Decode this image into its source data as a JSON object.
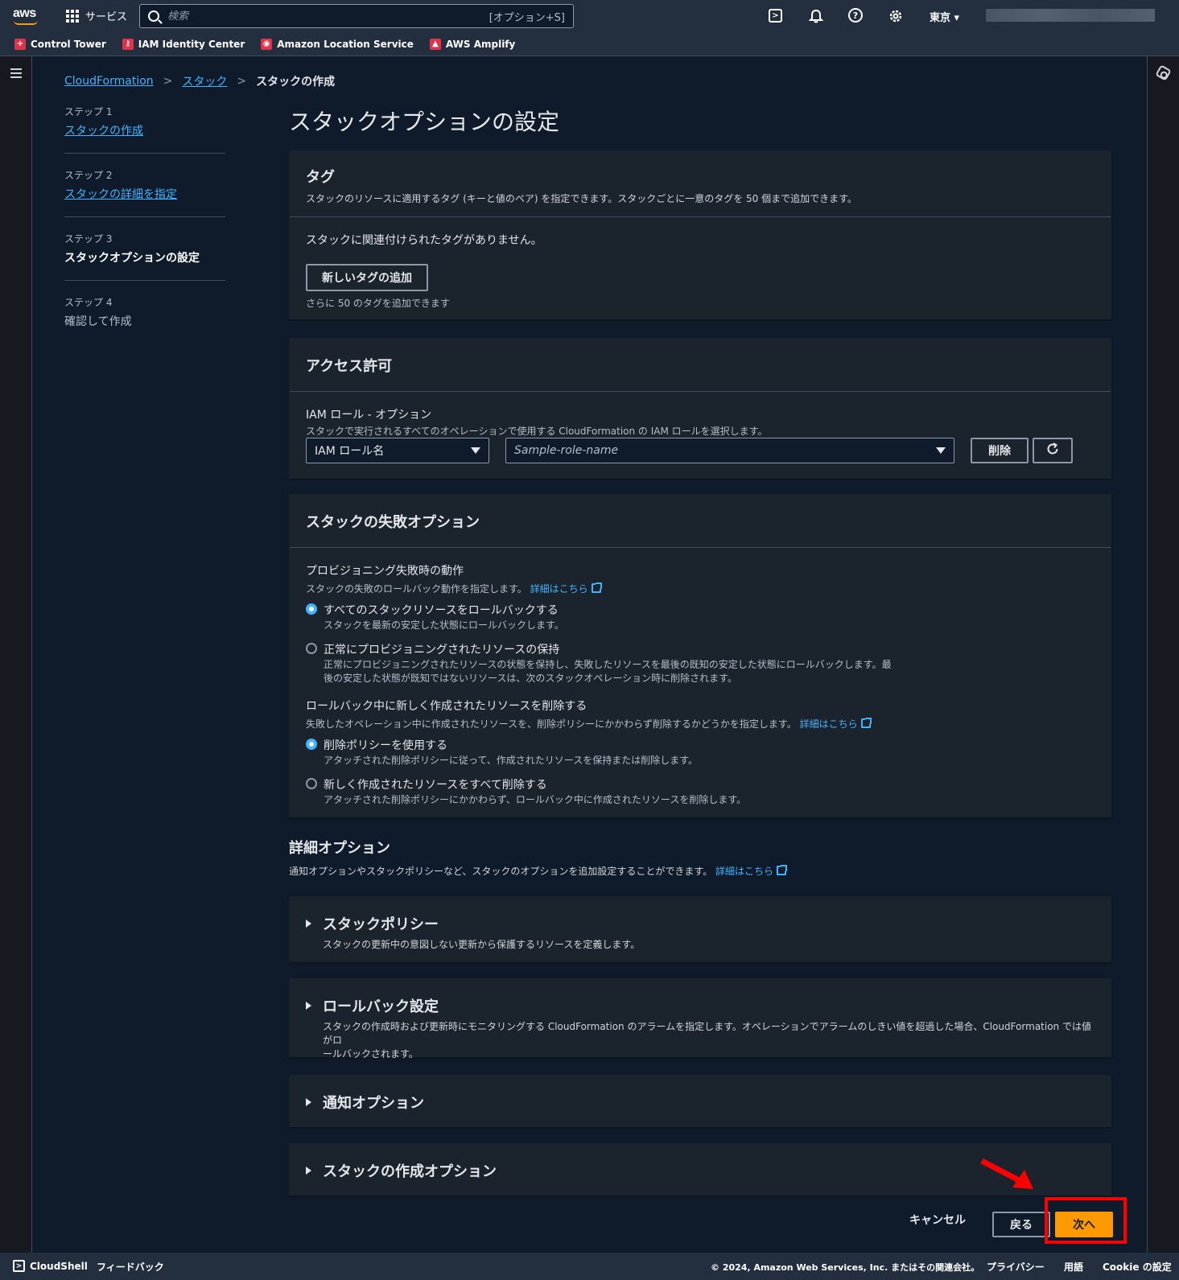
{
  "topnav": {
    "logo_text": "aws",
    "services_label": "サービス",
    "search_placeholder": "検索",
    "search_shortcut": "[オプション+S]",
    "region": "東京 ▾"
  },
  "favorites": [
    {
      "label": "Control Tower",
      "icon": "control-tower-icon"
    },
    {
      "label": "IAM Identity Center",
      "icon": "iam-identity-center-icon"
    },
    {
      "label": "Amazon Location Service",
      "icon": "location-service-icon"
    },
    {
      "label": "AWS Amplify",
      "icon": "amplify-icon"
    }
  ],
  "breadcrumb": {
    "items": [
      "CloudFormation",
      "スタック"
    ],
    "current": "スタックの作成"
  },
  "steps": [
    {
      "num": "ステップ 1",
      "label": "スタックの作成"
    },
    {
      "num": "ステップ 2",
      "label": "スタックの詳細を指定"
    },
    {
      "num": "ステップ 3",
      "label": "スタックオプションの設定"
    },
    {
      "num": "ステップ 4",
      "label": "確認して作成"
    }
  ],
  "page_title": "スタックオプションの設定",
  "tags": {
    "title": "タグ",
    "description": "スタックのリソースに適用するタグ (キーと値のペア) を指定できます。スタックごとに一意のタグを 50 個まで追加できます。",
    "empty": "スタックに関連付けられたタグがありません。",
    "add_button": "新しいタグの追加",
    "hint": "さらに 50 のタグを追加できます"
  },
  "access": {
    "title": "アクセス許可",
    "label": "IAM ロール - オプション",
    "description": "スタックで実行されるすべてのオペレーションで使用する CloudFormation の IAM ロールを選択します。",
    "select_type": "IAM ロール名",
    "select_role_placeholder": "Sample-role-name",
    "delete_button": "削除"
  },
  "failure": {
    "title": "スタックの失敗オプション",
    "prov_label": "プロビジョニング失敗時の動作",
    "prov_desc": "スタックの失敗のロールバック動作を指定します。",
    "learn_more": "詳細はこちら",
    "opt1_label": "すべてのスタックリソースをロールバックする",
    "opt1_desc": "スタックを最新の安定した状態にロールバックします。",
    "opt2_label": "正常にプロビジョニングされたリソースの保持",
    "opt2_desc_1": "正常にプロビジョニングされたリソースの状態を保持し、失敗したリソースを最後の既知の安定した状態にロールバックします。最",
    "opt2_desc_2": "後の安定した状態が既知ではないリソースは、次のスタックオペレーション時に削除されます。",
    "del_label": "ロールバック中に新しく作成されたリソースを削除する",
    "del_desc": "失敗したオペレーション中に作成されたリソースを、削除ポリシーにかかわらず削除するかどうかを指定します。",
    "opt3_label": "削除ポリシーを使用する",
    "opt3_desc": "アタッチされた削除ポリシーに従って、作成されたリソースを保持または削除します。",
    "opt4_label": "新しく作成されたリソースをすべて削除する",
    "opt4_desc": "アタッチされた削除ポリシーにかかわらず、ロールバック中に作成されたリソースを削除します。"
  },
  "advanced": {
    "title": "詳細オプション",
    "description": "通知オプションやスタックポリシーなど、スタックのオプションを追加設定することができます。",
    "learn_more": "詳細はこちら",
    "policy_title": "スタックポリシー",
    "policy_desc": "スタックの更新中の意図しない更新から保護するリソースを定義します。",
    "rollback_title": "ロールバック設定",
    "rollback_desc_1": "スタックの作成時および更新時にモニタリングする CloudFormation のアラームを指定します。オペレーションでアラームのしきい値を超過した場合、CloudFormation では値がロ",
    "rollback_desc_2": "ールバックされます。",
    "notify_title": "通知オプション",
    "create_title": "スタックの作成オプション"
  },
  "actions": {
    "cancel": "キャンセル",
    "back": "戻る",
    "next": "次へ"
  },
  "footer": {
    "cloudshell": "CloudShell",
    "feedback": "フィードバック",
    "copyright": "© 2024, Amazon Web Services, Inc. またはその関連会社。",
    "privacy": "プライバシー",
    "terms": "用語",
    "cookie": "Cookie の設定"
  },
  "colors": {
    "primary_button": "#ff9900",
    "link": "#42b4ff",
    "annotation": "#ff0000"
  }
}
